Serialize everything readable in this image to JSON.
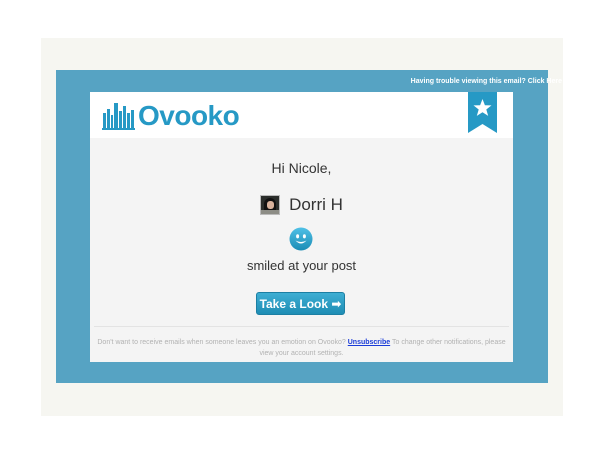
{
  "email": {
    "trouble_link": "Having trouble viewing this email? Click Here",
    "brand": {
      "name": "Ovooko",
      "logo_icon": "city-skyline-icon",
      "ribbon_icon": "star-ribbon-icon"
    },
    "greeting": "Hi Nicole,",
    "sender": {
      "name": "Dorri H",
      "avatar_icon": "user-avatar"
    },
    "emotion_icon": "smiley-icon",
    "action_text": "smiled at your post",
    "cta_label": "Take a Look ➡",
    "footer": {
      "text_before": "Don't want to receive emails when someone leaves you an emotion on Ovooko?",
      "unsubscribe_label": "Unsubscribe",
      "text_after": "To change other notifications, please view your account settings."
    },
    "colors": {
      "frame_blue": "#56a3c3",
      "brand_blue": "#2699c5",
      "button_blue": "#1e8db4",
      "link_blue": "#1a3bd8"
    }
  }
}
